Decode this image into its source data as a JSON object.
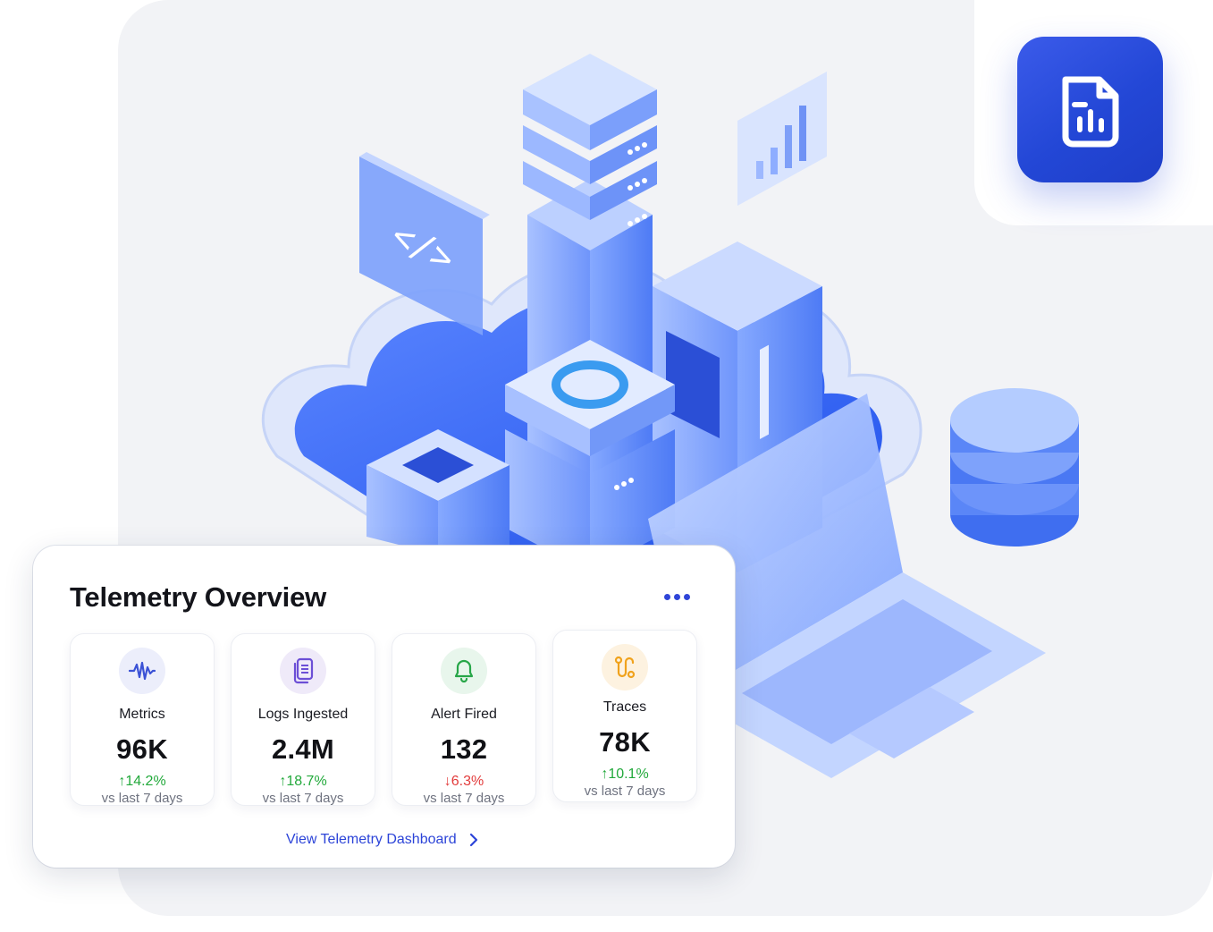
{
  "card": {
    "title": "Telemetry Overview",
    "link_label": "View Telemetry Dashboard",
    "stats": [
      {
        "icon": "waveform-icon",
        "label": "Metrics",
        "value": "96K",
        "delta": "14.2%",
        "direction": "up",
        "sub": "vs last 7 days",
        "accent": "#3b52d6",
        "bg": "#eceefb"
      },
      {
        "icon": "document-icon",
        "label": "Logs Ingested",
        "value": "2.4M",
        "delta": "18.7%",
        "direction": "up",
        "sub": "vs last 7 days",
        "accent": "#6c4fd6",
        "bg": "#efeaf9"
      },
      {
        "icon": "bell-icon",
        "label": "Alert Fired",
        "value": "132",
        "delta": "6.3%",
        "direction": "down",
        "sub": "vs last 7 days",
        "accent": "#27a648",
        "bg": "#e8f6ec"
      },
      {
        "icon": "route-icon",
        "label": "Traces",
        "value": "78K",
        "delta": "10.1%",
        "direction": "up",
        "sub": "vs last 7 days",
        "accent": "#f0a21c",
        "bg": "#fdf2e0"
      }
    ]
  },
  "colors": {
    "brand_blue": "#2347d6",
    "up_green": "#22a93b",
    "down_red": "#e23b3b"
  }
}
